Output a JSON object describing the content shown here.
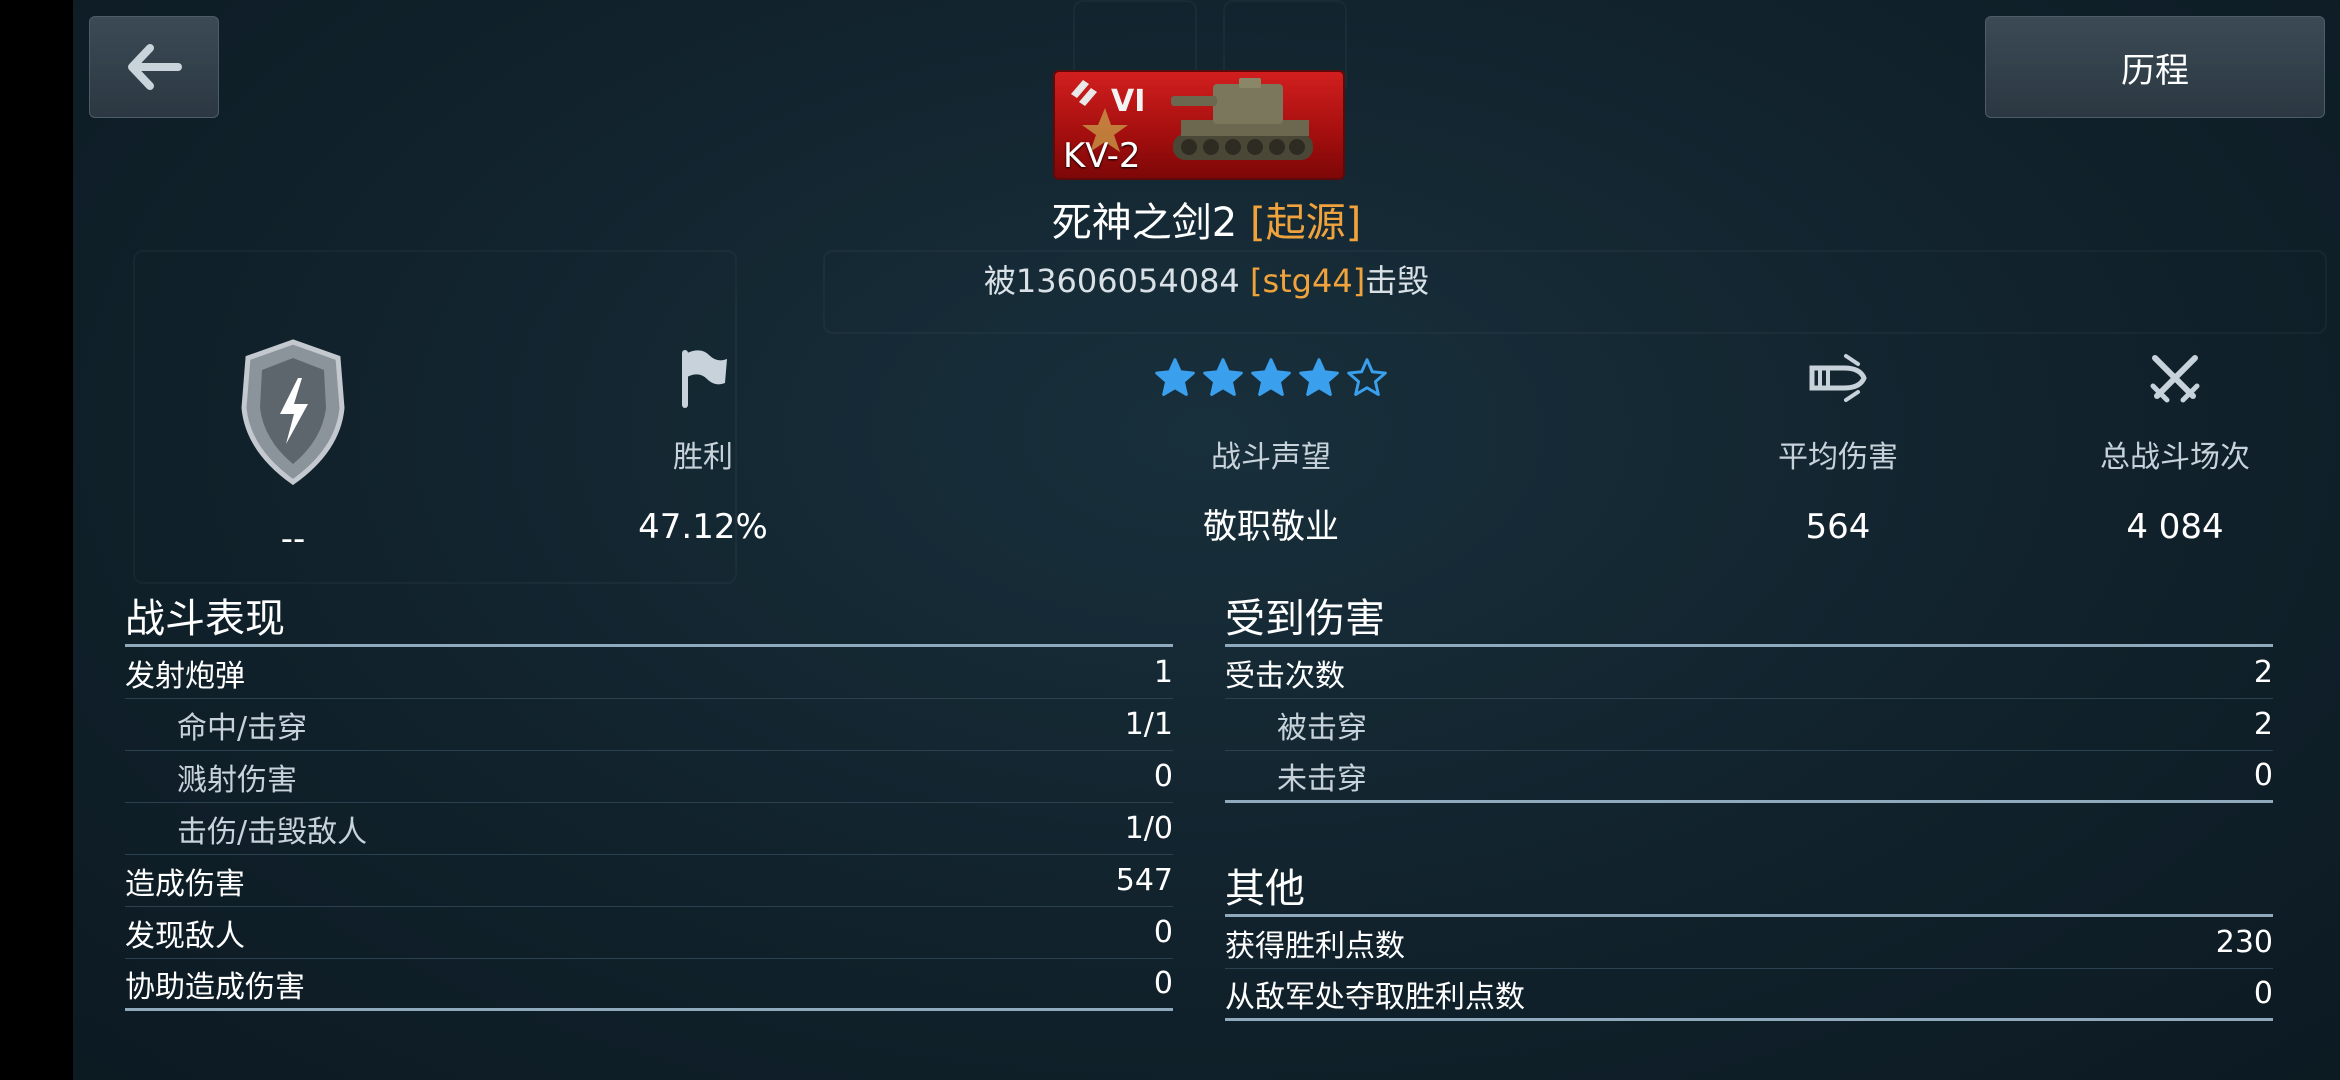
{
  "header": {
    "history_label": "历程"
  },
  "tank": {
    "tier": "VI",
    "name": "KV-2",
    "badge_color": "#c41616"
  },
  "player": {
    "name": "死神之剑2",
    "clan": "[起源]",
    "killed_prefix": "被",
    "killer_name": "13606054084",
    "killer_clan": "[stg44]",
    "killed_suffix": "击毁"
  },
  "stats": {
    "mastery": {
      "value": "--"
    },
    "wins": {
      "label": "胜利",
      "value": "47.12%"
    },
    "rating": {
      "label": "战斗声望",
      "value": "敬职敬业",
      "stars_filled": 4,
      "stars_total": 5
    },
    "avg_damage": {
      "label": "平均伤害",
      "value": "564"
    },
    "battles": {
      "label": "总战斗场次",
      "value": "4 084"
    }
  },
  "performance": {
    "title": "战斗表现",
    "rows": [
      {
        "label": "发射炮弹",
        "value": "1",
        "sub": false
      },
      {
        "label": "命中/击穿",
        "value": "1/1",
        "sub": true
      },
      {
        "label": "溅射伤害",
        "value": "0",
        "sub": true
      },
      {
        "label": "击伤/击毁敌人",
        "value": "1/0",
        "sub": true
      },
      {
        "label": "造成伤害",
        "value": "547",
        "sub": false
      },
      {
        "label": "发现敌人",
        "value": "0",
        "sub": false
      },
      {
        "label": "协助造成伤害",
        "value": "0",
        "sub": false
      }
    ]
  },
  "received": {
    "title": "受到伤害",
    "rows": [
      {
        "label": "受击次数",
        "value": "2",
        "sub": false
      },
      {
        "label": "被击穿",
        "value": "2",
        "sub": true
      },
      {
        "label": "未击穿",
        "value": "0",
        "sub": true
      }
    ]
  },
  "other": {
    "title": "其他",
    "rows": [
      {
        "label": "获得胜利点数",
        "value": "230",
        "sub": false
      },
      {
        "label": "从敌军处夺取胜利点数",
        "value": "0",
        "sub": false
      }
    ]
  },
  "colors": {
    "accent_orange": "#f0a33c",
    "star_blue": "#3aa0ee",
    "rule": "#8fa9bd"
  }
}
